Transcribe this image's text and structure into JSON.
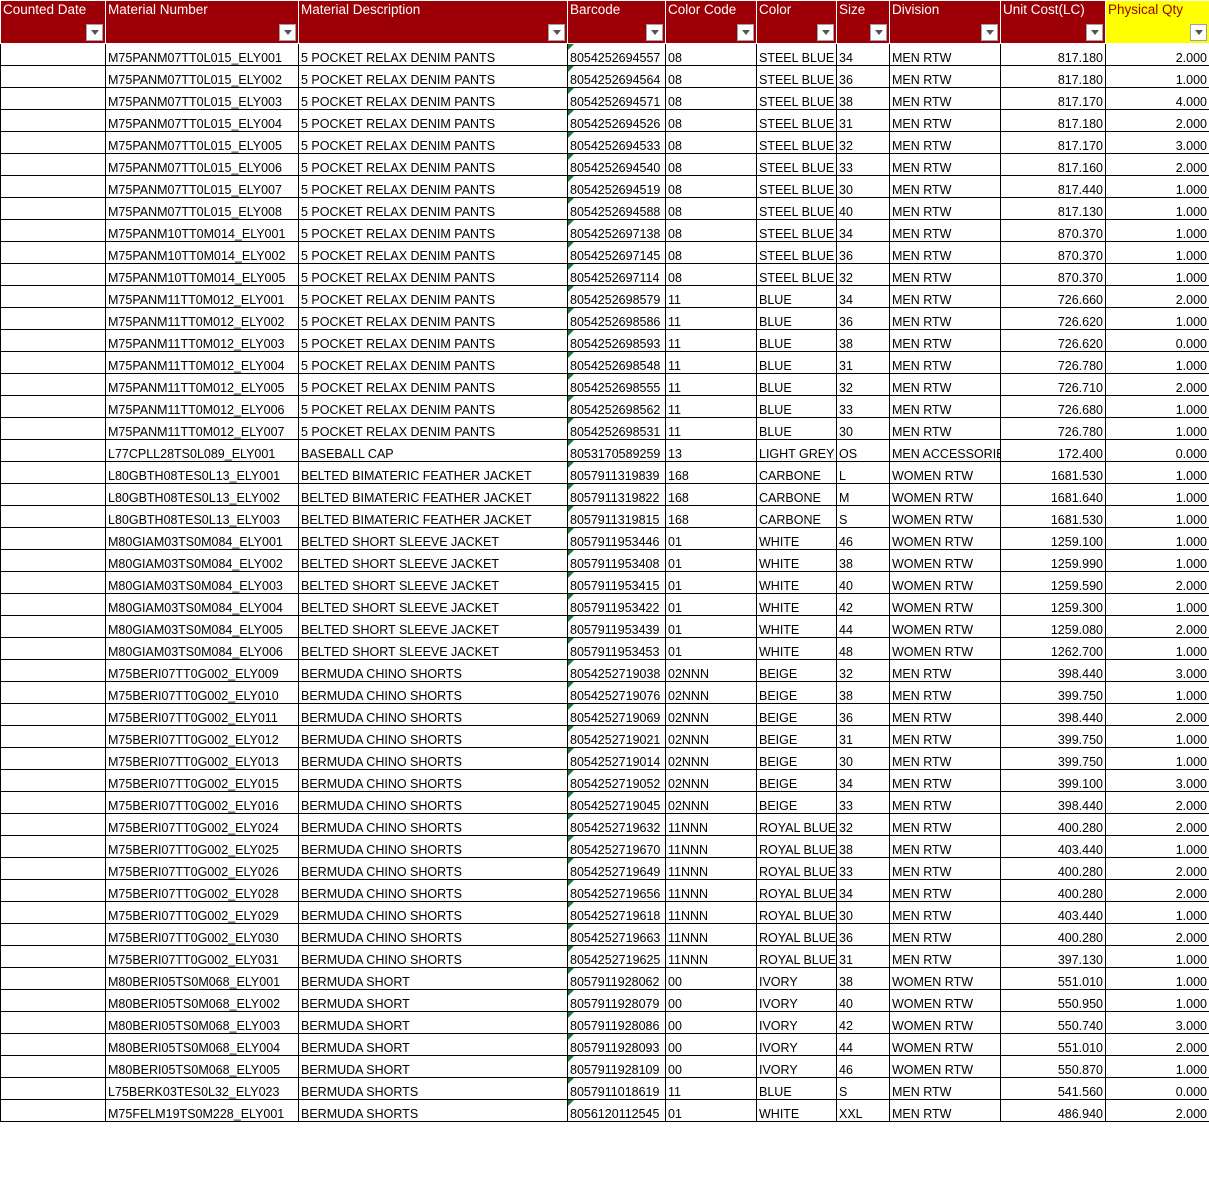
{
  "columns": [
    {
      "key": "counted_date",
      "label": "Counted Date"
    },
    {
      "key": "material_number",
      "label": "Material Number"
    },
    {
      "key": "material_description",
      "label": "Material Description"
    },
    {
      "key": "barcode",
      "label": "Barcode"
    },
    {
      "key": "color_code",
      "label": "Color Code"
    },
    {
      "key": "color",
      "label": "Color"
    },
    {
      "key": "size",
      "label": "Size"
    },
    {
      "key": "division",
      "label": "Division"
    },
    {
      "key": "unit_cost",
      "label": "Unit Cost(LC)"
    },
    {
      "key": "physical_qty",
      "label": "Physical Qty"
    }
  ],
  "colors": {
    "header_bg": "#9c0006",
    "header_text": "#ffffff",
    "highlight_bg": "#ffff00",
    "barcode_flag": "#1e7b34"
  },
  "rows": [
    [
      "",
      "M75PANM07TT0L015_ELY001",
      "5 POCKET RELAX DENIM PANTS",
      "8054252694557",
      "08",
      "STEEL BLUE",
      "34",
      "MEN RTW",
      "817.180",
      "2.000"
    ],
    [
      "",
      "M75PANM07TT0L015_ELY002",
      "5 POCKET RELAX DENIM PANTS",
      "8054252694564",
      "08",
      "STEEL BLUE",
      "36",
      "MEN RTW",
      "817.180",
      "1.000"
    ],
    [
      "",
      "M75PANM07TT0L015_ELY003",
      "5 POCKET RELAX DENIM PANTS",
      "8054252694571",
      "08",
      "STEEL BLUE",
      "38",
      "MEN RTW",
      "817.170",
      "4.000"
    ],
    [
      "",
      "M75PANM07TT0L015_ELY004",
      "5 POCKET RELAX DENIM PANTS",
      "8054252694526",
      "08",
      "STEEL BLUE",
      "31",
      "MEN RTW",
      "817.180",
      "2.000"
    ],
    [
      "",
      "M75PANM07TT0L015_ELY005",
      "5 POCKET RELAX DENIM PANTS",
      "8054252694533",
      "08",
      "STEEL BLUE",
      "32",
      "MEN RTW",
      "817.170",
      "3.000"
    ],
    [
      "",
      "M75PANM07TT0L015_ELY006",
      "5 POCKET RELAX DENIM PANTS",
      "8054252694540",
      "08",
      "STEEL BLUE",
      "33",
      "MEN RTW",
      "817.160",
      "2.000"
    ],
    [
      "",
      "M75PANM07TT0L015_ELY007",
      "5 POCKET RELAX DENIM PANTS",
      "8054252694519",
      "08",
      "STEEL BLUE",
      "30",
      "MEN RTW",
      "817.440",
      "1.000"
    ],
    [
      "",
      "M75PANM07TT0L015_ELY008",
      "5 POCKET RELAX DENIM PANTS",
      "8054252694588",
      "08",
      "STEEL BLUE",
      "40",
      "MEN RTW",
      "817.130",
      "1.000"
    ],
    [
      "",
      "M75PANM10TT0M014_ELY001",
      "5 POCKET RELAX DENIM PANTS",
      "8054252697138",
      "08",
      "STEEL BLUE",
      "34",
      "MEN RTW",
      "870.370",
      "1.000"
    ],
    [
      "",
      "M75PANM10TT0M014_ELY002",
      "5 POCKET RELAX DENIM PANTS",
      "8054252697145",
      "08",
      "STEEL BLUE",
      "36",
      "MEN RTW",
      "870.370",
      "1.000"
    ],
    [
      "",
      "M75PANM10TT0M014_ELY005",
      "5 POCKET RELAX DENIM PANTS",
      "8054252697114",
      "08",
      "STEEL BLUE",
      "32",
      "MEN RTW",
      "870.370",
      "1.000"
    ],
    [
      "",
      "M75PANM11TT0M012_ELY001",
      "5 POCKET RELAX DENIM PANTS",
      "8054252698579",
      "11",
      "BLUE",
      "34",
      "MEN RTW",
      "726.660",
      "2.000"
    ],
    [
      "",
      "M75PANM11TT0M012_ELY002",
      "5 POCKET RELAX DENIM PANTS",
      "8054252698586",
      "11",
      "BLUE",
      "36",
      "MEN RTW",
      "726.620",
      "1.000"
    ],
    [
      "",
      "M75PANM11TT0M012_ELY003",
      "5 POCKET RELAX DENIM PANTS",
      "8054252698593",
      "11",
      "BLUE",
      "38",
      "MEN RTW",
      "726.620",
      "0.000"
    ],
    [
      "",
      "M75PANM11TT0M012_ELY004",
      "5 POCKET RELAX DENIM PANTS",
      "8054252698548",
      "11",
      "BLUE",
      "31",
      "MEN RTW",
      "726.780",
      "1.000"
    ],
    [
      "",
      "M75PANM11TT0M012_ELY005",
      "5 POCKET RELAX DENIM PANTS",
      "8054252698555",
      "11",
      "BLUE",
      "32",
      "MEN RTW",
      "726.710",
      "2.000"
    ],
    [
      "",
      "M75PANM11TT0M012_ELY006",
      "5 POCKET RELAX DENIM PANTS",
      "8054252698562",
      "11",
      "BLUE",
      "33",
      "MEN RTW",
      "726.680",
      "1.000"
    ],
    [
      "",
      "M75PANM11TT0M012_ELY007",
      "5 POCKET RELAX DENIM PANTS",
      "8054252698531",
      "11",
      "BLUE",
      "30",
      "MEN RTW",
      "726.780",
      "1.000"
    ],
    [
      "",
      "L77CPLL28TS0L089_ELY001",
      "BASEBALL CAP",
      "8053170589259",
      "13",
      "LIGHT GREY",
      "OS",
      "MEN ACCESSORIES",
      "172.400",
      "0.000"
    ],
    [
      "",
      "L80GBTH08TES0L13_ELY001",
      "BELTED BIMATERIC FEATHER JACKET",
      "8057911319839",
      "168",
      "CARBONE",
      "L",
      "WOMEN RTW",
      "1681.530",
      "1.000"
    ],
    [
      "",
      "L80GBTH08TES0L13_ELY002",
      "BELTED BIMATERIC FEATHER JACKET",
      "8057911319822",
      "168",
      "CARBONE",
      "M",
      "WOMEN RTW",
      "1681.640",
      "1.000"
    ],
    [
      "",
      "L80GBTH08TES0L13_ELY003",
      "BELTED BIMATERIC FEATHER JACKET",
      "8057911319815",
      "168",
      "CARBONE",
      "S",
      "WOMEN RTW",
      "1681.530",
      "1.000"
    ],
    [
      "",
      "M80GIAM03TS0M084_ELY001",
      "BELTED SHORT SLEEVE JACKET",
      "8057911953446",
      "01",
      "WHITE",
      "46",
      "WOMEN RTW",
      "1259.100",
      "1.000"
    ],
    [
      "",
      "M80GIAM03TS0M084_ELY002",
      "BELTED SHORT SLEEVE JACKET",
      "8057911953408",
      "01",
      "WHITE",
      "38",
      "WOMEN RTW",
      "1259.990",
      "1.000"
    ],
    [
      "",
      "M80GIAM03TS0M084_ELY003",
      "BELTED SHORT SLEEVE JACKET",
      "8057911953415",
      "01",
      "WHITE",
      "40",
      "WOMEN RTW",
      "1259.590",
      "2.000"
    ],
    [
      "",
      "M80GIAM03TS0M084_ELY004",
      "BELTED SHORT SLEEVE JACKET",
      "8057911953422",
      "01",
      "WHITE",
      "42",
      "WOMEN RTW",
      "1259.300",
      "1.000"
    ],
    [
      "",
      "M80GIAM03TS0M084_ELY005",
      "BELTED SHORT SLEEVE JACKET",
      "8057911953439",
      "01",
      "WHITE",
      "44",
      "WOMEN RTW",
      "1259.080",
      "2.000"
    ],
    [
      "",
      "M80GIAM03TS0M084_ELY006",
      "BELTED SHORT SLEEVE JACKET",
      "8057911953453",
      "01",
      "WHITE",
      "48",
      "WOMEN RTW",
      "1262.700",
      "1.000"
    ],
    [
      "",
      "M75BERI07TT0G002_ELY009",
      "BERMUDA CHINO SHORTS",
      "8054252719038",
      "02NNN",
      "BEIGE",
      "32",
      "MEN RTW",
      "398.440",
      "3.000"
    ],
    [
      "",
      "M75BERI07TT0G002_ELY010",
      "BERMUDA CHINO SHORTS",
      "8054252719076",
      "02NNN",
      "BEIGE",
      "38",
      "MEN RTW",
      "399.750",
      "1.000"
    ],
    [
      "",
      "M75BERI07TT0G002_ELY011",
      "BERMUDA CHINO SHORTS",
      "8054252719069",
      "02NNN",
      "BEIGE",
      "36",
      "MEN RTW",
      "398.440",
      "2.000"
    ],
    [
      "",
      "M75BERI07TT0G002_ELY012",
      "BERMUDA CHINO SHORTS",
      "8054252719021",
      "02NNN",
      "BEIGE",
      "31",
      "MEN RTW",
      "399.750",
      "1.000"
    ],
    [
      "",
      "M75BERI07TT0G002_ELY013",
      "BERMUDA CHINO SHORTS",
      "8054252719014",
      "02NNN",
      "BEIGE",
      "30",
      "MEN RTW",
      "399.750",
      "1.000"
    ],
    [
      "",
      "M75BERI07TT0G002_ELY015",
      "BERMUDA CHINO SHORTS",
      "8054252719052",
      "02NNN",
      "BEIGE",
      "34",
      "MEN RTW",
      "399.100",
      "3.000"
    ],
    [
      "",
      "M75BERI07TT0G002_ELY016",
      "BERMUDA CHINO SHORTS",
      "8054252719045",
      "02NNN",
      "BEIGE",
      "33",
      "MEN RTW",
      "398.440",
      "2.000"
    ],
    [
      "",
      "M75BERI07TT0G002_ELY024",
      "BERMUDA CHINO SHORTS",
      "8054252719632",
      "11NNN",
      "ROYAL BLUE",
      "32",
      "MEN RTW",
      "400.280",
      "2.000"
    ],
    [
      "",
      "M75BERI07TT0G002_ELY025",
      "BERMUDA CHINO SHORTS",
      "8054252719670",
      "11NNN",
      "ROYAL BLUE",
      "38",
      "MEN RTW",
      "403.440",
      "1.000"
    ],
    [
      "",
      "M75BERI07TT0G002_ELY026",
      "BERMUDA CHINO SHORTS",
      "8054252719649",
      "11NNN",
      "ROYAL BLUE",
      "33",
      "MEN RTW",
      "400.280",
      "2.000"
    ],
    [
      "",
      "M75BERI07TT0G002_ELY028",
      "BERMUDA CHINO SHORTS",
      "8054252719656",
      "11NNN",
      "ROYAL BLUE",
      "34",
      "MEN RTW",
      "400.280",
      "2.000"
    ],
    [
      "",
      "M75BERI07TT0G002_ELY029",
      "BERMUDA CHINO SHORTS",
      "8054252719618",
      "11NNN",
      "ROYAL BLUE",
      "30",
      "MEN RTW",
      "403.440",
      "1.000"
    ],
    [
      "",
      "M75BERI07TT0G002_ELY030",
      "BERMUDA CHINO SHORTS",
      "8054252719663",
      "11NNN",
      "ROYAL BLUE",
      "36",
      "MEN RTW",
      "400.280",
      "2.000"
    ],
    [
      "",
      "M75BERI07TT0G002_ELY031",
      "BERMUDA CHINO SHORTS",
      "8054252719625",
      "11NNN",
      "ROYAL BLUE",
      "31",
      "MEN RTW",
      "397.130",
      "1.000"
    ],
    [
      "",
      "M80BERI05TS0M068_ELY001",
      "BERMUDA SHORT",
      "8057911928062",
      "00",
      "IVORY",
      "38",
      "WOMEN RTW",
      "551.010",
      "1.000"
    ],
    [
      "",
      "M80BERI05TS0M068_ELY002",
      "BERMUDA SHORT",
      "8057911928079",
      "00",
      "IVORY",
      "40",
      "WOMEN RTW",
      "550.950",
      "1.000"
    ],
    [
      "",
      "M80BERI05TS0M068_ELY003",
      "BERMUDA SHORT",
      "8057911928086",
      "00",
      "IVORY",
      "42",
      "WOMEN RTW",
      "550.740",
      "3.000"
    ],
    [
      "",
      "M80BERI05TS0M068_ELY004",
      "BERMUDA SHORT",
      "8057911928093",
      "00",
      "IVORY",
      "44",
      "WOMEN RTW",
      "551.010",
      "2.000"
    ],
    [
      "",
      "M80BERI05TS0M068_ELY005",
      "BERMUDA SHORT",
      "8057911928109",
      "00",
      "IVORY",
      "46",
      "WOMEN RTW",
      "550.870",
      "1.000"
    ],
    [
      "",
      "L75BERK03TES0L32_ELY023",
      "BERMUDA SHORTS",
      "8057911018619",
      "11",
      "BLUE",
      "S",
      "MEN RTW",
      "541.560",
      "0.000"
    ],
    [
      "",
      "M75FELM19TS0M228_ELY001",
      "BERMUDA SHORTS",
      "8056120112545",
      "01",
      "WHITE",
      "XXL",
      "MEN RTW",
      "486.940",
      "2.000"
    ]
  ]
}
